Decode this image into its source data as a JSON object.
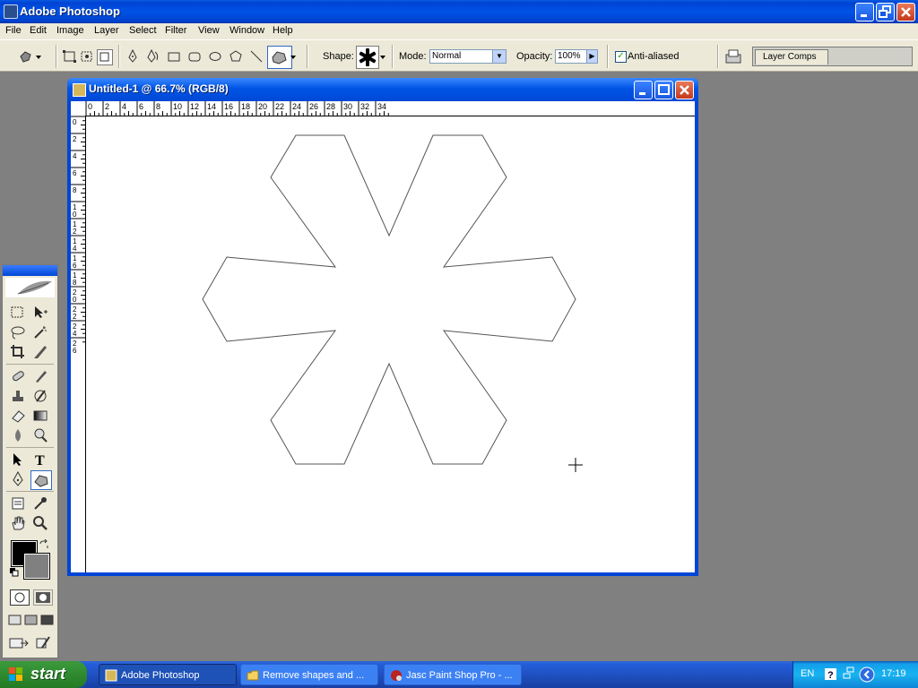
{
  "app": {
    "title": "Adobe Photoshop"
  },
  "menu": [
    "File",
    "Edit",
    "Image",
    "Layer",
    "Select",
    "Filter",
    "View",
    "Window",
    "Help"
  ],
  "options": {
    "shape_label": "Shape:",
    "mode_label": "Mode:",
    "mode_value": "Normal",
    "opacity_label": "Opacity:",
    "opacity_value": "100%",
    "antialias_label": "Anti-aliased",
    "antialias_checked": true,
    "layer_comps_tab": "Layer Comps"
  },
  "document": {
    "title": "Untitled-1 @ 66.7% (RGB/8)",
    "ruler_top_labels": [
      "0",
      "2",
      "4",
      "6",
      "8",
      "10",
      "12",
      "14",
      "16",
      "18",
      "20",
      "22",
      "24",
      "26",
      "28",
      "30",
      "32",
      "34"
    ],
    "ruler_left_labels": [
      "0",
      "2",
      "4",
      "6",
      "8",
      "10",
      "12",
      "14",
      "16",
      "18",
      "20",
      "22",
      "24",
      "26"
    ]
  },
  "taskbar": {
    "start_label": "start",
    "tasks": [
      "Adobe Photoshop",
      "Remove shapes and ...",
      "Jasc Paint Shop Pro - ..."
    ],
    "tray_lang": "EN",
    "clock": "17:19"
  },
  "colors": {
    "foreground": "#000000",
    "background": "#808080",
    "title_blue": "#0053e6",
    "taskbar_blue": "#245edb"
  }
}
